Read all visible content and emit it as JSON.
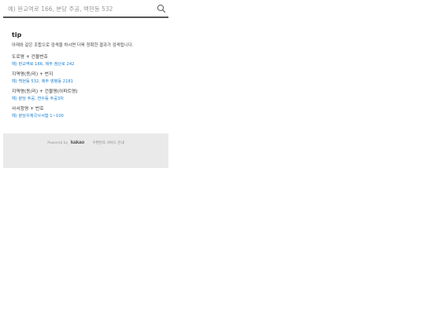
{
  "search": {
    "placeholder": "예) 판교역로 166, 분당 주공, 백현동 532"
  },
  "tip": {
    "title": "tip",
    "description": "아래와 같은 조합으로 검색을 하시면 더욱 정확한 결과가 검색됩니다.",
    "items": [
      {
        "label": "도로명 + 건물번호",
        "example": "예) 판교역로 166,  제주 첨단로 242"
      },
      {
        "label": "지역명(동/리) + 번지",
        "example": "예) 백현동 532,  제주 영평동 2181"
      },
      {
        "label": "지역명(동/리) + 건물명(아파트명)",
        "example": "예) 분당 주공,  연수동 주공3차"
      },
      {
        "label": "사서함명 + 번호",
        "example": "예) 분당우체국사서함 1~100"
      }
    ]
  },
  "footer": {
    "powered_by": "Powered by",
    "brand": "kakao",
    "link_text": "우편번호 서비스 안내"
  },
  "colors": {
    "example_text": "#1a7fcf",
    "footer_bg": "#eaeaea",
    "search_underline": "#555555"
  }
}
